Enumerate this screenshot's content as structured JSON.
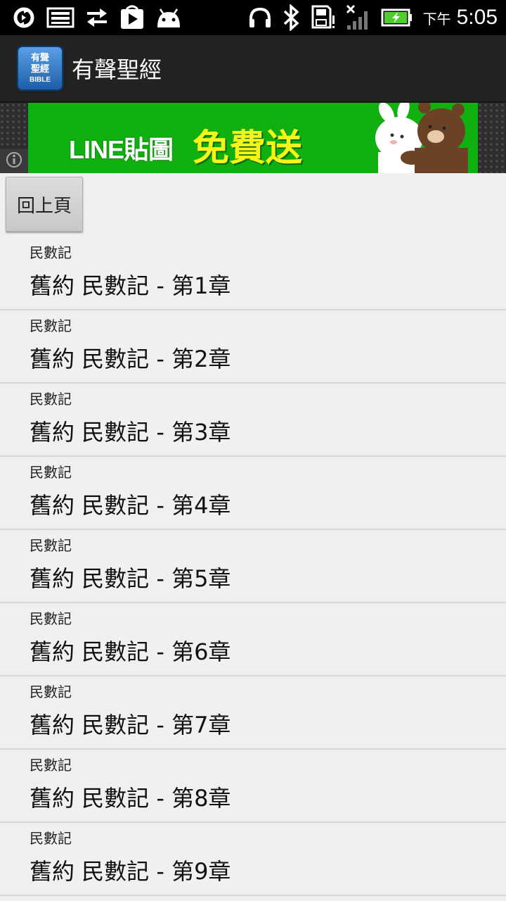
{
  "status_bar": {
    "ampm": "下午",
    "time": "5:05"
  },
  "action_bar": {
    "app_icon": {
      "line1": "有聲",
      "line2": "聖經",
      "line3": "BIBLE"
    },
    "title": "有聲聖經"
  },
  "ad": {
    "line_text": "LINE貼圖",
    "free_text": "免費送"
  },
  "back_button_label": "回上頁",
  "chapters": [
    {
      "sub": "民數記",
      "title": "舊約 民數記 - 第1章"
    },
    {
      "sub": "民數記",
      "title": "舊約 民數記 - 第2章"
    },
    {
      "sub": "民數記",
      "title": "舊約 民數記 - 第3章"
    },
    {
      "sub": "民數記",
      "title": "舊約 民數記 - 第4章"
    },
    {
      "sub": "民數記",
      "title": "舊約 民數記 - 第5章"
    },
    {
      "sub": "民數記",
      "title": "舊約 民數記 - 第6章"
    },
    {
      "sub": "民數記",
      "title": "舊約 民數記 - 第7章"
    },
    {
      "sub": "民數記",
      "title": "舊約 民數記 - 第8章"
    },
    {
      "sub": "民數記",
      "title": "舊約 民數記 - 第9章"
    }
  ],
  "colors": {
    "action_bar": "#222222",
    "ad_green": "#10b010",
    "ad_yellow": "#f5f51a",
    "battery_green": "#4ccf2a"
  }
}
